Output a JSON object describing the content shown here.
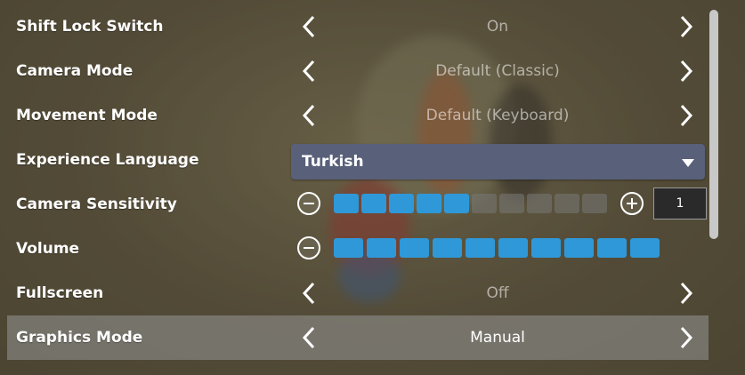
{
  "settings": {
    "shift_lock": {
      "label": "Shift Lock Switch",
      "value": "On"
    },
    "camera_mode": {
      "label": "Camera Mode",
      "value": "Default (Classic)"
    },
    "movement_mode": {
      "label": "Movement Mode",
      "value": "Default (Keyboard)"
    },
    "experience_language": {
      "label": "Experience Language",
      "value": "Turkish"
    },
    "camera_sensitivity": {
      "label": "Camera Sensitivity",
      "filled": 5,
      "total": 10,
      "value": "1"
    },
    "volume": {
      "label": "Volume",
      "filled": 10,
      "total": 10
    },
    "fullscreen": {
      "label": "Fullscreen",
      "value": "Off"
    },
    "graphics_mode": {
      "label": "Graphics Mode",
      "value": "Manual"
    }
  },
  "colors": {
    "slider_on": "#2f98d8",
    "dropdown_bg": "#58607a",
    "highlight_row": "#969696"
  },
  "icons": [
    "chevron-left-icon",
    "chevron-right-icon",
    "minus-circle-icon",
    "plus-circle-icon",
    "caret-down-icon"
  ]
}
